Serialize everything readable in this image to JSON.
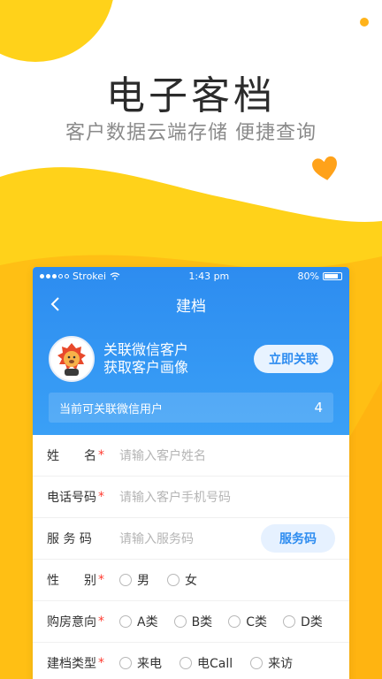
{
  "hero": {
    "title": "电子客档",
    "subtitle": "客户数据云端存储 便捷查询"
  },
  "status_bar": {
    "carrier": "Strokei",
    "time": "1:43 pm",
    "battery": "80%"
  },
  "nav": {
    "title": "建档",
    "back_icon": "chevron-left-icon"
  },
  "wechat_link": {
    "line1": "关联微信客户",
    "line2": "获取客户画像",
    "button_label": "立即关联",
    "count_label": "当前可关联微信用户",
    "count_value": "4"
  },
  "form": {
    "name": {
      "label": "姓　　名",
      "placeholder": "请输入客户姓名"
    },
    "phone": {
      "label": "电话号码",
      "placeholder": "请输入客户手机号码"
    },
    "service": {
      "label": "服 务 码",
      "placeholder": "请输入服务码",
      "button_label": "服务码"
    },
    "gender": {
      "label": "性　　别",
      "options": [
        "男",
        "女"
      ]
    },
    "intent": {
      "label": "购房意向",
      "options": [
        "A类",
        "B类",
        "C类",
        "D类"
      ]
    },
    "type": {
      "label": "建档类型",
      "options": [
        "来电",
        "电Call",
        "来访"
      ]
    }
  },
  "colors": {
    "primary": "#2d8cf0",
    "accent_yellow": "#ffd21a",
    "accent_orange": "#ffad0f",
    "required": "#ff3b30"
  }
}
